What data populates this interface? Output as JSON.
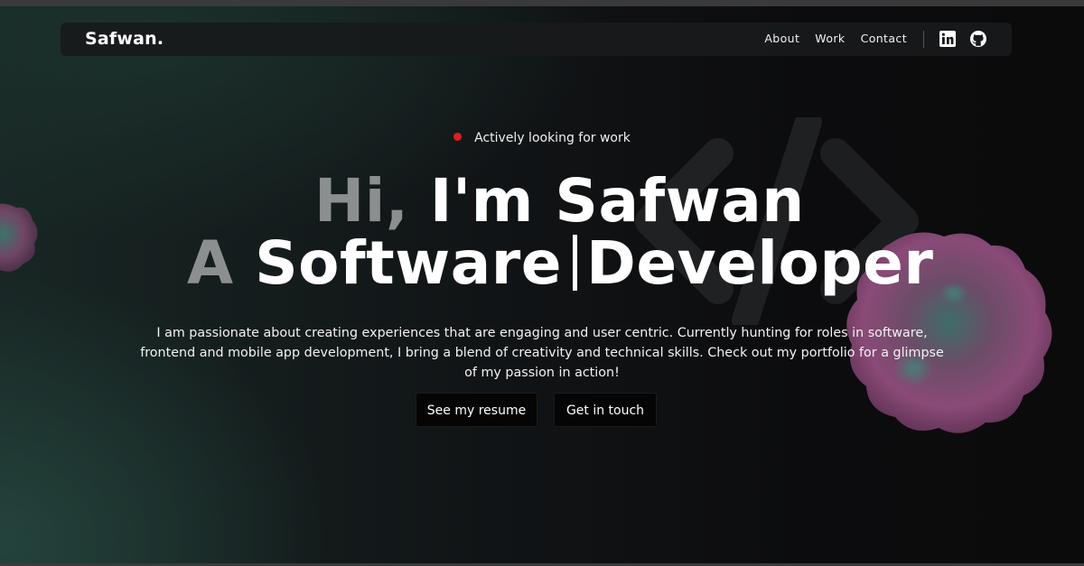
{
  "navbar": {
    "logo": "Safwan.",
    "links": [
      "About",
      "Work",
      "Contact"
    ],
    "social": [
      "linkedin-icon",
      "github-icon"
    ]
  },
  "hero": {
    "status": "Actively looking for work",
    "status_color": "#e11d1d",
    "line1_muted": "Hi,",
    "line1_bright": "I'm Safwan",
    "line2_muted": "A",
    "line2_word1": "Software",
    "line2_word2": "Developer",
    "description": "I am passionate about creating experiences that are engaging and user centric. Currently hunting for roles in software, frontend and mobile app development, I bring a blend of creativity and technical skills. Check out my portfolio for a glimpse of my passion in action!"
  },
  "buttons": {
    "resume": "See my resume",
    "contact": "Get in touch"
  },
  "colors": {
    "accent_blob": "#8a4a78",
    "muted_text": "#8c8f90"
  }
}
